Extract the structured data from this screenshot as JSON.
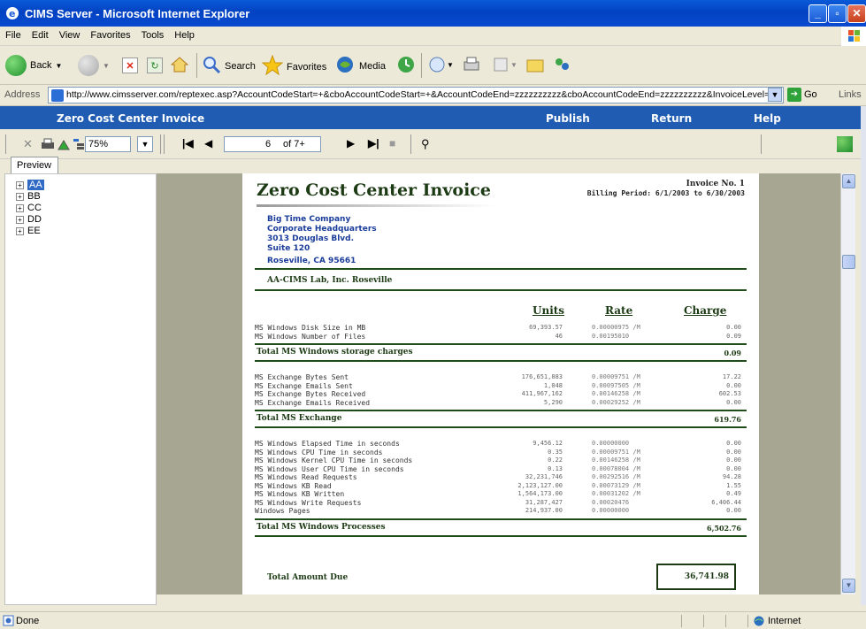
{
  "window": {
    "title": "CIMS Server - Microsoft Internet Explorer",
    "controls": {
      "minimize": "_",
      "maximize": "▫",
      "close": "✕"
    }
  },
  "menu": [
    "File",
    "Edit",
    "View",
    "Favorites",
    "Tools",
    "Help"
  ],
  "toolbar": {
    "back": "Back",
    "search": "Search",
    "favorites": "Favorites",
    "media": "Media"
  },
  "address": {
    "label": "Address",
    "url": "http://www.cimsserver.com/reptexec.asp?AccountCodeStart=+&cboAccountCodeStart=+&AccountCodeEnd=zzzzzzzzzz&cboAccountCodeEnd=zzzzzzzzzz&InvoiceLevel=",
    "go": "Go",
    "links": "Links"
  },
  "app_header": {
    "title": "Zero Cost Center Invoice",
    "publish": "Publish",
    "return": "Return",
    "help": "Help"
  },
  "report_toolbar": {
    "zoom": "75%",
    "page": "6",
    "page_of": "of 7+"
  },
  "tabs": {
    "preview": "Preview"
  },
  "tree": [
    "AA",
    "BB",
    "CC",
    "DD",
    "EE"
  ],
  "report": {
    "title": "Zero Cost Center Invoice",
    "invoice_no": "Invoice No. 1",
    "billing_period": "Billing Period: 6/1/2003 to 6/30/2003",
    "address": [
      "Big Time Company",
      "Corporate Headquarters",
      "3013 Douglas Blvd.",
      "Suite 120",
      "Roseville, CA 95661"
    ],
    "account": "AA-CIMS Lab, Inc. Roseville",
    "headers": {
      "units": "Units",
      "rate": "Rate",
      "charge": "Charge"
    },
    "sections": [
      {
        "rows": [
          {
            "label": "MS Windows Disk Size in MB",
            "units": "69,393.57",
            "rate": "0.00000975 /M",
            "charge": "0.00"
          },
          {
            "label": "MS Windows Number of Files",
            "units": "46",
            "rate": "0.00195010",
            "charge": "0.09"
          }
        ],
        "total_label": "Total MS Windows storage charges",
        "total": "0.09"
      },
      {
        "rows": [
          {
            "label": "MS Exchange Bytes Sent",
            "units": "176,651,883",
            "rate": "0.00009751 /M",
            "charge": "17.22"
          },
          {
            "label": "MS Exchange Emails Sent",
            "units": "1,048",
            "rate": "0.00097505 /M",
            "charge": "0.00"
          },
          {
            "label": "MS Exchange Bytes Received",
            "units": "411,967,162",
            "rate": "0.00146258 /M",
            "charge": "602.53"
          },
          {
            "label": "MS Exchange Emails Received",
            "units": "5,290",
            "rate": "0.00029252 /M",
            "charge": "0.00"
          }
        ],
        "total_label": "Total MS Exchange",
        "total": "619.76"
      },
      {
        "rows": [
          {
            "label": "MS Windows Elapsed Time in seconds",
            "units": "9,456.12",
            "rate": "0.00000000",
            "charge": "0.00"
          },
          {
            "label": "MS Windows CPU Time in seconds",
            "units": "0.35",
            "rate": "0.00009751 /M",
            "charge": "0.00"
          },
          {
            "label": "MS Windows Kernel CPU Time in seconds",
            "units": "0.22",
            "rate": "0.00146258 /M",
            "charge": "0.00"
          },
          {
            "label": "MS Windows User CPU Time in seconds",
            "units": "0.13",
            "rate": "0.00078004 /M",
            "charge": "0.00"
          },
          {
            "label": "MS Windows Read Requests",
            "units": "32,231,746",
            "rate": "0.00292516 /M",
            "charge": "94.28"
          },
          {
            "label": "MS Windows KB Read",
            "units": "2,123,127.00",
            "rate": "0.00073129 /M",
            "charge": "1.55"
          },
          {
            "label": "MS Windows KB Written",
            "units": "1,564,173.00",
            "rate": "0.00031202 /M",
            "charge": "0.49"
          },
          {
            "label": "MS Windows Write Requests",
            "units": "31,287,427",
            "rate": "0.00020476",
            "charge": "6,406.44"
          },
          {
            "label": "Windows Pages",
            "units": "214,937.00",
            "rate": "0.00000000",
            "charge": "0.00"
          }
        ],
        "total_label": "Total MS Windows Processes",
        "total": "6,502.76"
      }
    ],
    "due_label": "Total Amount Due",
    "due": "36,741.98"
  },
  "status": {
    "left": "Done",
    "zone": "Internet"
  }
}
